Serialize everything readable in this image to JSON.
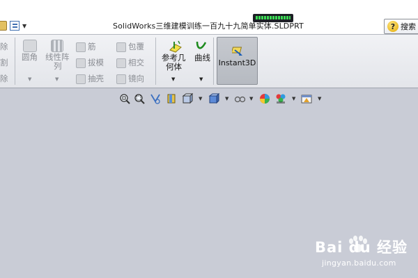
{
  "titlebar": {
    "title": "SolidWorks三维建模训练一百九十九简单实体.SLDPRT",
    "search_label": "搜索",
    "help_glyph": "?"
  },
  "ribbon": {
    "partial_items": [
      "除",
      "割",
      "除"
    ],
    "fillet": "圆角",
    "linear_pattern_line1": "线性阵",
    "linear_pattern_line2": "列",
    "rib": "筋",
    "draft": "拔模",
    "shell": "抽壳",
    "wrap": "包覆",
    "intersect": "相交",
    "mirror": "镜向",
    "ref_geometry_line1": "参考几",
    "ref_geometry_line2": "何体",
    "curves": "曲线",
    "instant3d": "Instant3D"
  },
  "view_toolbar": {
    "icons": [
      "zoom-to-fit-icon",
      "zoom-to-area-icon",
      "previous-view-icon",
      "section-view-icon",
      "dynamic-annotation-view-icon",
      "view-orientation-icon",
      "display-style-icon",
      "hide-show-items-icon",
      "edit-appearance-icon",
      "apply-scene-icon",
      "view-settings-icon"
    ]
  },
  "watermark": {
    "brand": "Bai du 经验",
    "url": "jingyan.baidu.com"
  },
  "colors": {
    "canvas": "#c9ccd6",
    "ribbon": "#e8e9ed",
    "active_toggle": "#b9bcc3",
    "status_green": "#3ddc56"
  }
}
